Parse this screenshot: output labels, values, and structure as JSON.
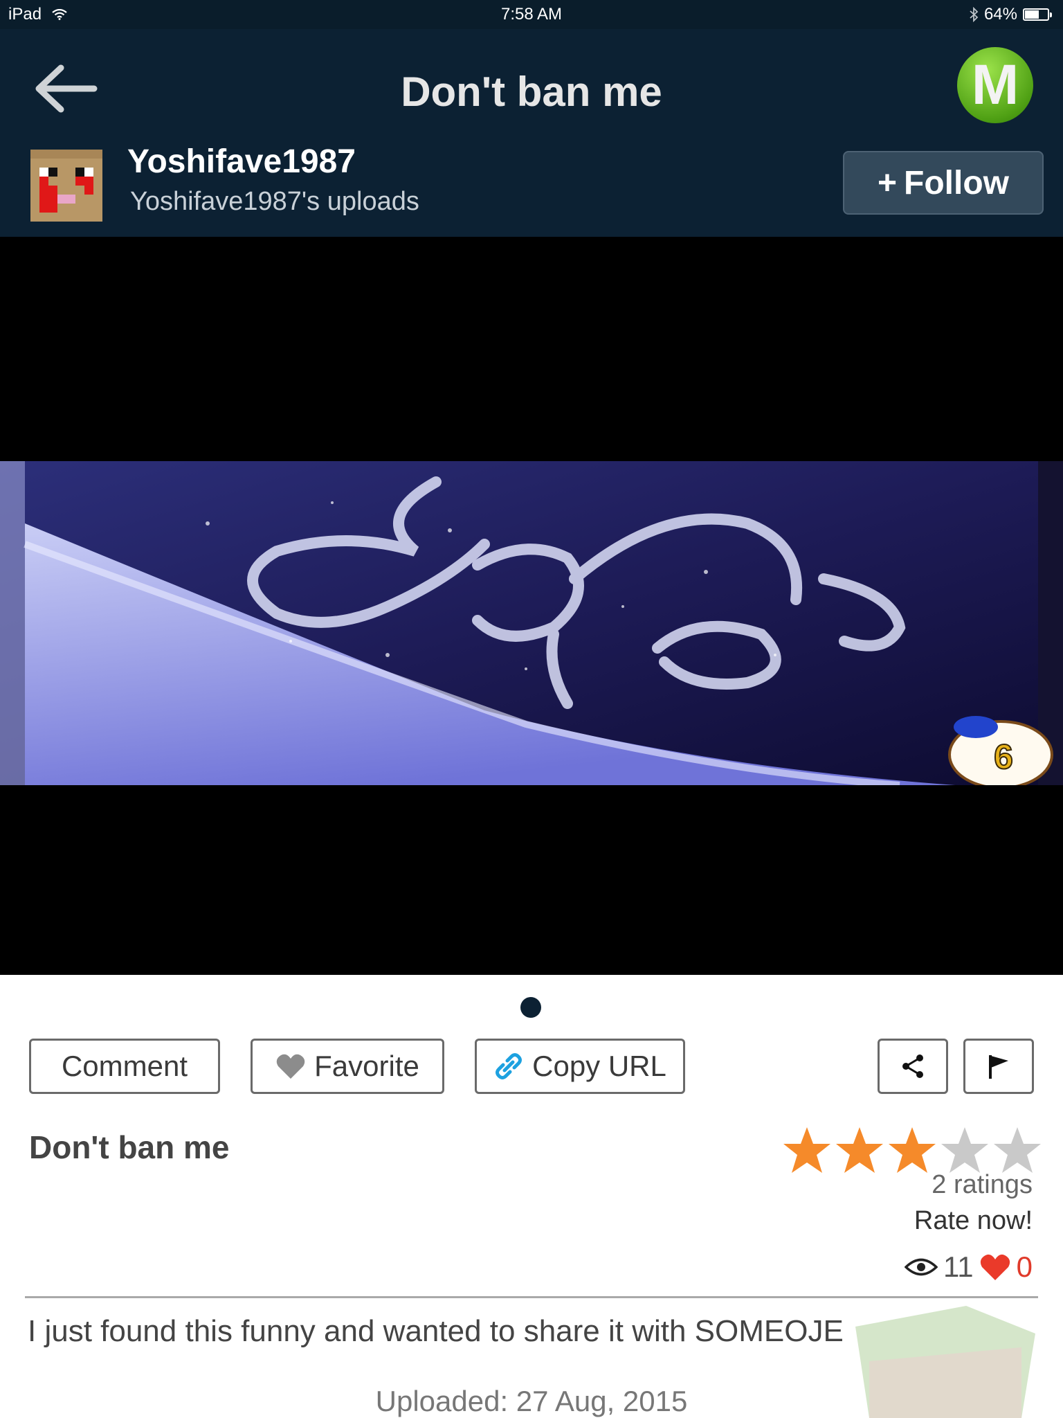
{
  "status_bar": {
    "device": "iPad",
    "time": "7:58 AM",
    "battery_text": "64%",
    "battery_level": 0.64
  },
  "header": {
    "title": "Don't ban me",
    "logo_letter": "M"
  },
  "user": {
    "name": "Yoshifave1987",
    "uploads_label": "Yoshifave1987's uploads",
    "follow_label": "Follow"
  },
  "video": {
    "badge_number": "6"
  },
  "actions": {
    "comment": "Comment",
    "favorite": "Favorite",
    "copy_url": "Copy URL"
  },
  "content": {
    "title": "Don't ban me",
    "rating_stars": 3,
    "rating_max": 5,
    "ratings_count": "2 ratings",
    "rate_now": "Rate now!",
    "views": "11",
    "likes": "0",
    "description": "I just found this funny and wanted to share it with SOMEOJE",
    "uploaded": "Uploaded: 27 Aug, 2015"
  },
  "colors": {
    "header_bg": "#0c2133",
    "accent_green": "#4fa014",
    "star_filled": "#f58a2a",
    "heart": "#ea3a2a"
  }
}
